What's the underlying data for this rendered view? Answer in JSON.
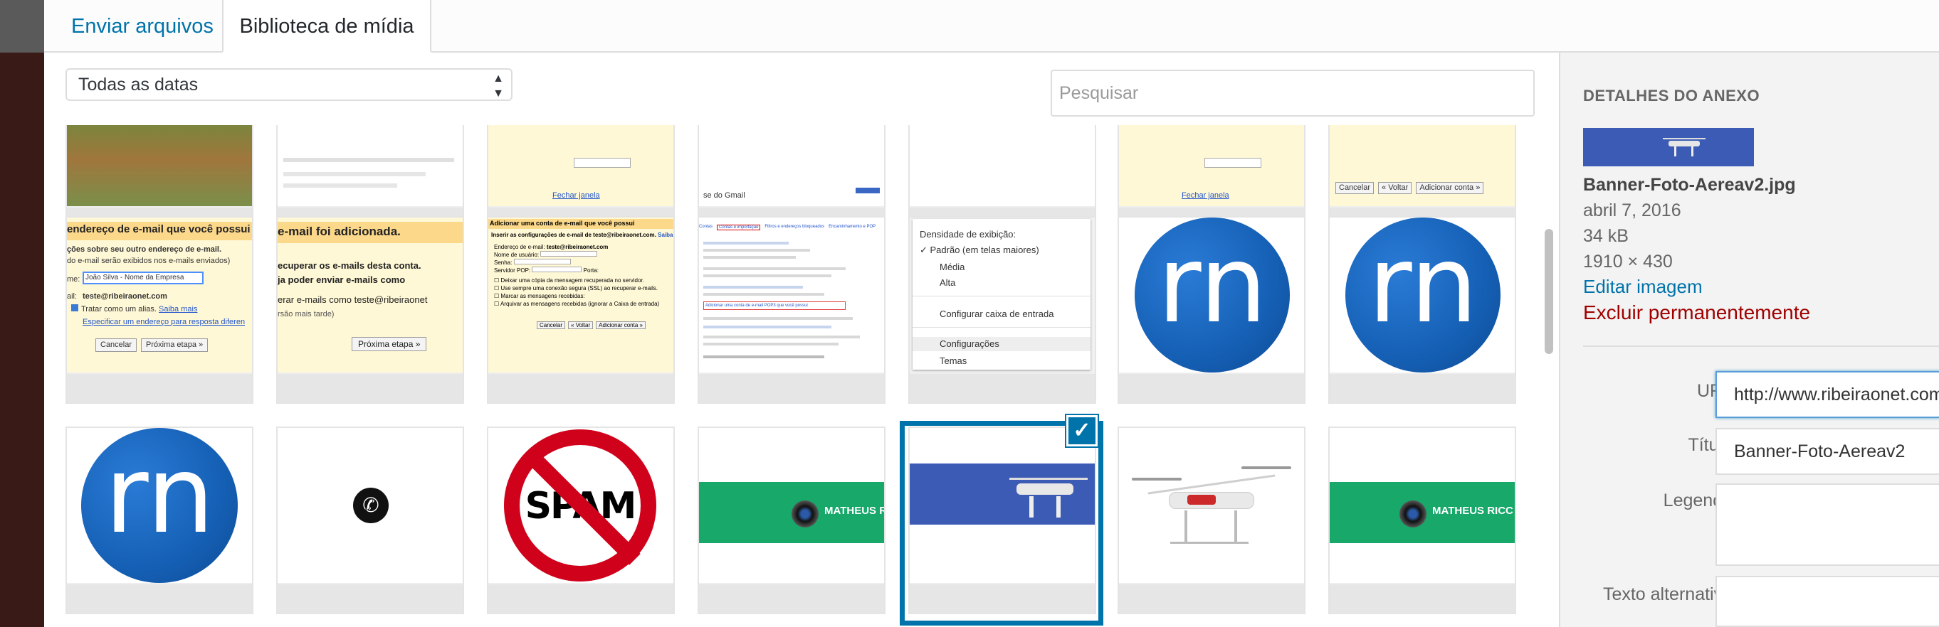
{
  "tabs": {
    "upload": "Enviar arquivos",
    "library": "Biblioteca de mídia"
  },
  "toolbar": {
    "date_filter": "Todas as datas",
    "search_placeholder": "Pesquisar"
  },
  "thumbs": {
    "row1": {
      "t2_link": "Fechar janela",
      "t3_link": "Fechar janela",
      "t5_text": "se do Gmail",
      "t6_link": "Fechar janela",
      "t7_buttons": [
        "Cancelar",
        "« Voltar",
        "Adicionar conta »"
      ]
    },
    "row2": {
      "t1": {
        "heading": "endereço de e-mail que você possui",
        "line1": "ções sobre seu outro endereço de e-mail.",
        "line2": "do e-mail serão exibidos nos e-mails enviados)",
        "name_label": "me:",
        "name_value": "João Silva - Nome da Empresa",
        "email_label": "ail:",
        "email_value": "teste@ribeiraonet.com",
        "alias": "Tratar como um alias.",
        "learn": "Saiba mais",
        "reply": "Especificar um endereço para resposta diferen",
        "cancel": "Cancelar",
        "next": "Próxima etapa »"
      },
      "t2": {
        "heading": "e-mail foi adicionada.",
        "line1": "ecuperar os e-mails desta conta.",
        "line2": "ja poder enviar e-mails como",
        "line2_email": "teste@ribeiraone",
        "line3": "erar e-mails como teste@ribeiraonet",
        "line4": "rsão mais tarde)",
        "next": "Próxima etapa »"
      },
      "t3": {
        "heading": "Adicionar uma conta de e-mail que você possui",
        "line1": "Inserir as configurações de e-mail de teste@ribeiraonet.com.",
        "learn": "Saiba mais",
        "email_label": "Endereço de e-mail:",
        "email_value": "teste@ribeiraonet.com",
        "user_label": "Nome de usuário:",
        "pass_label": "Senha:",
        "pop_label": "Servidor POP:",
        "port_label": "Porta:",
        "opt1": "Deixar uma cópia da mensagem recuperada no servidor.",
        "opt2": "Use sempre uma conexão segura (SSL) ao recuperar e-mails.",
        "opt3": "Marcar as mensagens recebidas:",
        "opt4": "Arquivar as mensagens recebidas (ignorar a Caixa de entrada)",
        "buttons": [
          "Cancelar",
          "« Voltar",
          "Adicionar conta »"
        ]
      },
      "t4": {
        "tabs": [
          "Contas e importação",
          "Filtros e endereços bloqueados",
          "Encaminhamento e POP"
        ],
        "highlight": "Adicionar uma conta de e-mail POP3 que você possui"
      },
      "t5": {
        "title": "Densidade de exibição:",
        "opt1": "Padrão (em telas maiores)",
        "opt2": "Média",
        "opt3": "Alta",
        "config_inbox": "Configurar caixa de entrada",
        "settings": "Configurações",
        "themes": "Temas"
      },
      "t6_logo": "rn",
      "t7_logo": "rn"
    },
    "row3": {
      "t1_logo": "rn",
      "t3_text": "SPAM",
      "t4_text": "MATHEUS R",
      "t7_text": "MATHEUS RICC"
    }
  },
  "sidebar": {
    "heading": "DETALHES DO ANEXO",
    "filename": "Banner-Foto-Aereav2.jpg",
    "date": "abril 7, 2016",
    "size": "34 kB",
    "dimensions": "1910 × 430",
    "edit_link": "Editar imagem",
    "delete_link": "Excluir permanentemente",
    "url_label": "URL",
    "url_value": "http://www.ribeiraonet.com",
    "title_label": "Título",
    "title_value": "Banner-Foto-Aereav2",
    "caption_label": "Legenda",
    "caption_value": "",
    "alt_label": "Texto alternativo",
    "alt_value": ""
  },
  "colors": {
    "accent": "#0073aa",
    "delete": "#a00000",
    "rn_blue": "#1560b5",
    "spam_red": "#d0021b",
    "banner_green": "#17a86a",
    "banner_blue": "#3c5bb5"
  }
}
